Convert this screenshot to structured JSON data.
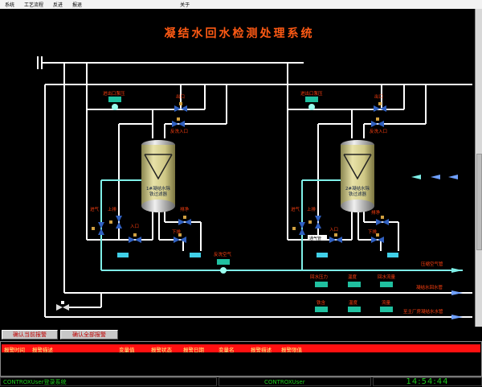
{
  "menu": [
    "系统",
    "工艺流程",
    "反进",
    "报退",
    "关于"
  ],
  "title": "凝结水回水检测处理系统",
  "colors": {
    "title": "#ff5a14",
    "label": "#ff4010",
    "pipe_blue": "#ffffff",
    "pipe_cyan": "#7ff0e8",
    "tank": "#d8d090",
    "alarm_bar": "#ff1010",
    "status_green": "#1ec81e"
  },
  "tank1": {
    "line1": "1#凝结水除",
    "line2": "铁过滤器"
  },
  "tank2": {
    "line1": "2#凝结水除",
    "line2": "铁过滤器"
  },
  "labels": {
    "inlet_pump_1": "进出口泵压",
    "outlet_1": "出口",
    "backwash_in_1": "反洗入口",
    "vent_1": "进气",
    "top_drain_1": "上排",
    "inlet_1": "入口",
    "flush_1": "排净",
    "bottom_drain_1": "下排",
    "inlet_pump_2": "进出口泵压",
    "outlet_2": "出口",
    "backwash_in_2": "反洗入口",
    "vent_2": "进气",
    "top_drain_2": "上排",
    "inlet_2": "入口",
    "flush_2": "排净",
    "bottom_drain_2": "下排",
    "vent_tube": "通气管",
    "backwash_air": "反洗空气",
    "air_pipe": "压缩空气管",
    "return_pipe": "凝结水回水管",
    "to_factory": "至主厂房凝结水水管",
    "return_pressure": "回水压力",
    "temperature": "温度",
    "return_flow": "回水流量",
    "iron": "铁含",
    "temperature_2": "温度",
    "flow": "流量"
  },
  "alarm": {
    "ack_current": "确认当前报警",
    "ack_all": "确认全部报警",
    "columns": [
      "报警时间",
      "报警描述",
      "变量值",
      "报警状态",
      "报警日期",
      "变量名",
      "报警描述",
      "报警限值"
    ]
  },
  "status": {
    "left": "CONTROXUser登录系统",
    "mid": "CONTROXUser",
    "clock": "14:54:44"
  }
}
